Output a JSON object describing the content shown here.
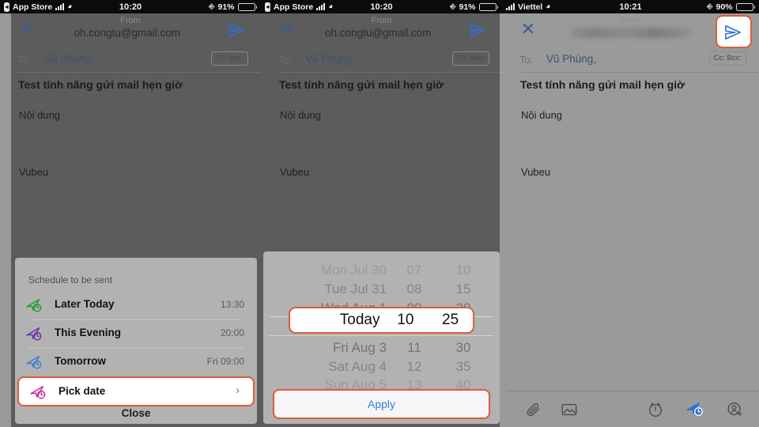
{
  "panels": [
    {
      "id": "panel-schedule-options",
      "statusbar": {
        "carrier": "App Store",
        "back_chip": "◂",
        "time": "10:20",
        "battery": "91%",
        "lock_icon": "rotation-lock"
      },
      "compose": {
        "from_label": "From",
        "from_address": "oh.congtu@gmail.com",
        "from_caret": "⌄",
        "to_label": "To:",
        "to_value": "Vũ Phùng,",
        "ccbcc": "Cc: Bcc:",
        "subject": "Test tính năng gửi mail hẹn giờ",
        "body": "Nội dung",
        "signature": "Vubeu"
      },
      "sheet": {
        "title": "Schedule to be sent",
        "rows": [
          {
            "label": "Later Today",
            "value": "13:30",
            "icon": "send-clock-green-icon",
            "color": "#1f9c2f",
            "highlighted": false
          },
          {
            "label": "This Evening",
            "value": "20:00",
            "icon": "send-clock-purple-icon",
            "color": "#6b2ea8",
            "highlighted": false
          },
          {
            "label": "Tomorrow",
            "value": "Fri 09:00",
            "icon": "send-clock-blue-icon",
            "color": "#3b7fc4",
            "highlighted": false
          },
          {
            "label": "Pick date",
            "value": "›",
            "icon": "send-clock-magenta-icon",
            "color": "#c2269b",
            "highlighted": true
          }
        ],
        "close_label": "Close"
      }
    },
    {
      "id": "panel-date-picker",
      "statusbar": {
        "carrier": "App Store",
        "back_chip": "◂",
        "time": "10:20",
        "battery": "91%",
        "lock_icon": "rotation-lock"
      },
      "compose": {
        "from_label": "From",
        "from_address": "oh.congtu@gmail.com",
        "from_caret": "⌄",
        "to_label": "To:",
        "to_value": "Vũ Phùng,",
        "ccbcc": "Cc: Bcc:",
        "subject": "Test tính năng gửi mail hẹn giờ",
        "body": "Nội dung",
        "signature": "Vubeu"
      },
      "picker": {
        "rows": [
          {
            "date": "Mon Jul 30",
            "dow": "Mon",
            "day": "Jul 30",
            "hour": "07",
            "minute": "10",
            "state": "faint"
          },
          {
            "date": "Tue Jul 31",
            "dow": "Tue",
            "day": "Jul 31",
            "hour": "08",
            "minute": "15",
            "state": "dim"
          },
          {
            "date": "Wed Aug 1",
            "dow": "Wed",
            "day": "Aug 1",
            "hour": "09",
            "minute": "20",
            "state": "near"
          },
          {
            "date": "Today",
            "dow": "Today",
            "day": "",
            "hour": "10",
            "minute": "25",
            "state": "selected"
          },
          {
            "date": "Fri Aug 3",
            "dow": "Fri",
            "day": "Aug 3",
            "hour": "11",
            "minute": "30",
            "state": "near"
          },
          {
            "date": "Sat Aug 4",
            "dow": "Sat",
            "day": "Aug 4",
            "hour": "12",
            "minute": "35",
            "state": "dim"
          },
          {
            "date": "Sun Aug 5",
            "dow": "Sun",
            "day": "Aug 5",
            "hour": "13",
            "minute": "40",
            "state": "faint"
          }
        ],
        "apply_label": "Apply"
      }
    },
    {
      "id": "panel-compose-sent",
      "statusbar": {
        "carrier": "Viettel",
        "time": "10:21",
        "battery": "90%",
        "lock_icon": "rotation-lock"
      },
      "compose": {
        "from_label": "From",
        "from_address": "",
        "to_label": "To:",
        "to_value": "Vũ Phùng,",
        "ccbcc": "Cc: Bcc:",
        "subject": "Test tính năng gửi mail hẹn giờ",
        "body": "Nội dung",
        "signature": "Vubeu"
      },
      "toolbar": [
        {
          "name": "attachment-icon",
          "label": "Attach file"
        },
        {
          "name": "image-icon",
          "label": "Insert image"
        },
        {
          "name": "alarm-clock-icon",
          "label": "Remind me"
        },
        {
          "name": "send-later-icon",
          "label": "Schedule send"
        },
        {
          "name": "add-contact-icon",
          "label": "Add contact"
        }
      ]
    }
  ],
  "colors": {
    "highlight_border": "#de5b3a",
    "accent_blue": "#2f7fd6",
    "send_icon": "#2f6fd0",
    "dim_dark": "#5c5c5c",
    "dim_light": "#9a9a9a",
    "sheet_bg": "#b2b2b2",
    "battery": "#e8b71d"
  }
}
